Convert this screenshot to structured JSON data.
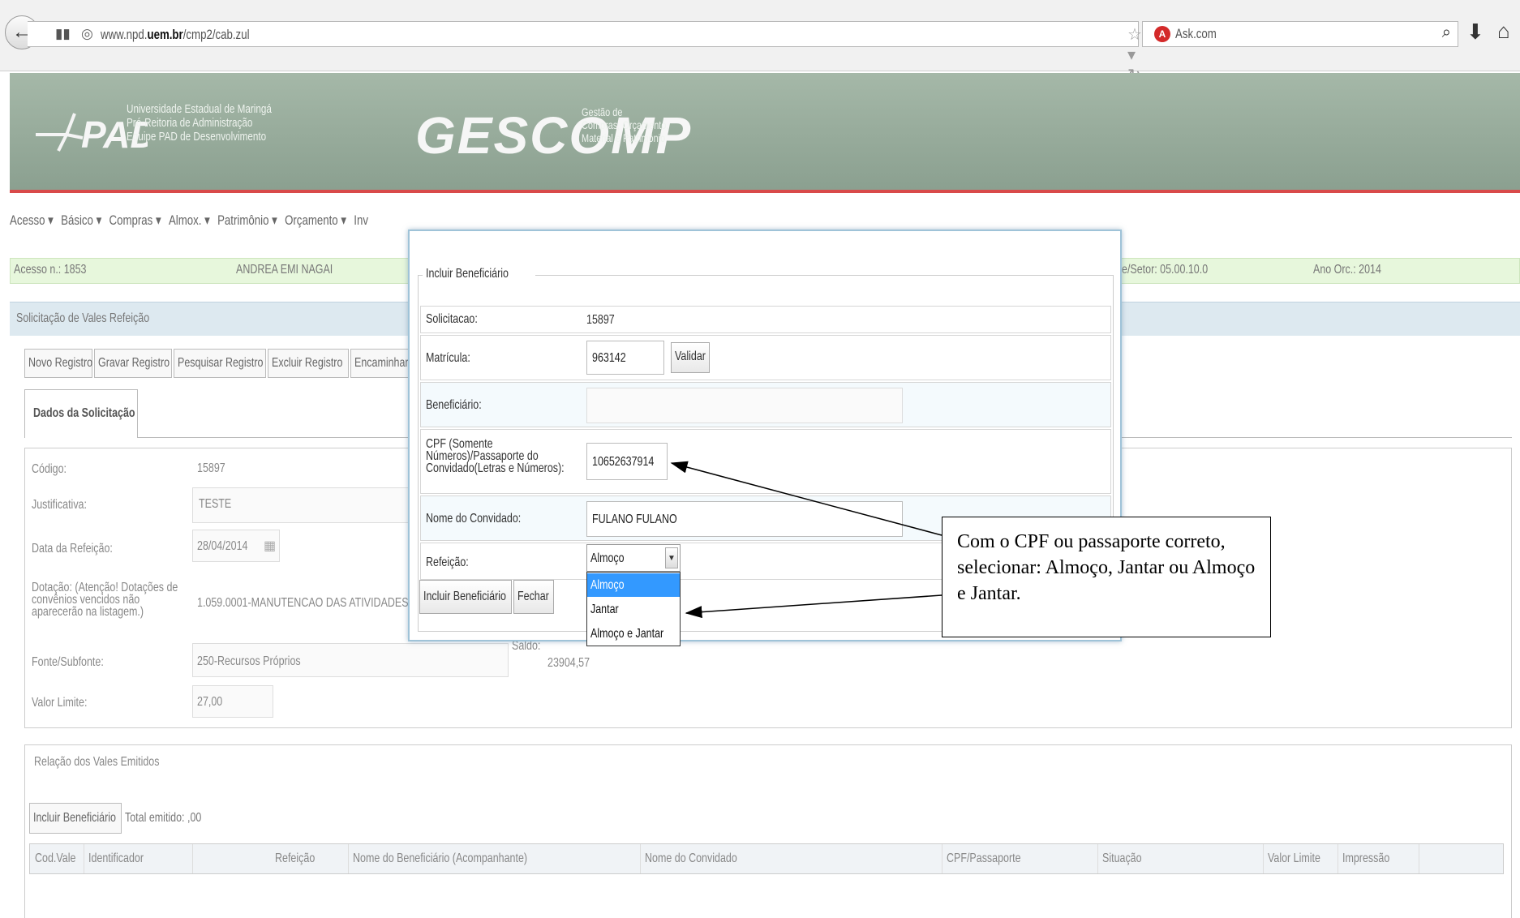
{
  "browser": {
    "url_prefix": "www.npd.",
    "url_bold": "uem.br",
    "url_suffix": "/cmp2/cab.zul",
    "search_engine": "Ask.com"
  },
  "header": {
    "pad_brand": "PAD",
    "pad_line1": "Universidade Estadual de Maringá",
    "pad_line2": "Pró-Reitoria de Administração",
    "pad_line3": "Equipe PAD de Desenvolvimento",
    "gescomp_brand": "GESCOMP",
    "gescomp_line1": "Gestão de",
    "gescomp_line2": "Compras, Orçamento,",
    "gescomp_line3": "Material e Patrimônio"
  },
  "menu": [
    "Acesso ▾",
    "Básico ▾",
    "Compras ▾",
    "Almox. ▾",
    "Patrimônio ▾",
    "Orçamento ▾",
    "Inv"
  ],
  "infobar": {
    "acesso": "Acesso n.: 1853",
    "user": "ANDREA EMI NAGAI",
    "setor": "e/Setor: 05.00.10.0",
    "ano": "Ano Orc.: 2014"
  },
  "panel": {
    "title": "Solicitação de Vales Refeição",
    "buttons": [
      "Novo Registro",
      "Gravar Registro",
      "Pesquisar Registro",
      "Excluir Registro",
      "Encaminhar"
    ],
    "tab": "Dados da Solicitação"
  },
  "form": {
    "codigo_label": "Código:",
    "codigo_value": "15897",
    "justificativa_label": "Justificativa:",
    "justificativa_value": "TESTE",
    "data_label": "Data da Refeição:",
    "data_value": "28/04/2014",
    "dotacao_label1": "Dotação: (Atenção! Dotações de",
    "dotacao_label2": "convênios vencidos não",
    "dotacao_label3": "aparecerão na listagem.)",
    "dotacao_value": "1.059.0001-MANUTENCAO DAS ATIVIDADES TE",
    "fonte_label": "Fonte/Subfonte:",
    "fonte_value": "250-Recursos Próprios",
    "saldo_label": "Saldo:",
    "saldo_value": "23904,57",
    "valor_label": "Valor Limite:",
    "valor_value": "27,00"
  },
  "vales": {
    "title": "Relação dos Vales Emitidos",
    "include_button": "Incluir Beneficiário",
    "total": "Total emitido: ,00",
    "columns": [
      "Cod.Vale",
      "Identificador",
      "Refeição",
      "Nome do Beneficiário (Acompanhante)",
      "Nome do Convidado",
      "CPF/Passaporte",
      "Situação",
      "Valor Limite",
      "Impressão"
    ]
  },
  "dialog": {
    "legend": "Incluir Beneficiário",
    "solicitacao_label": "Solicitacao:",
    "solicitacao_value": "15897",
    "matricula_label": "Matrícula:",
    "matricula_value": "963142",
    "validar_button": "Validar",
    "beneficiario_label": "Beneficiário:",
    "beneficiario_value": "",
    "cpf_label1": "CPF (Somente",
    "cpf_label2": "Números)/Passaporte do",
    "cpf_label3": "Convidado(Letras e Números):",
    "cpf_value": "10652637914",
    "convidado_label": "Nome do Convidado:",
    "convidado_value": "FULANO FULANO",
    "refeicao_label": "Refeição:",
    "refeicao_value": "Almoço",
    "refeicao_options": [
      "Almoço",
      "Jantar",
      "Almoço e Jantar"
    ],
    "incluir_button": "Incluir Beneficiário",
    "fechar_button": "Fechar"
  },
  "callout": {
    "text": "Com o CPF ou passaporte correto, selecionar: Almoço, Jantar ou Almoço e Jantar."
  }
}
